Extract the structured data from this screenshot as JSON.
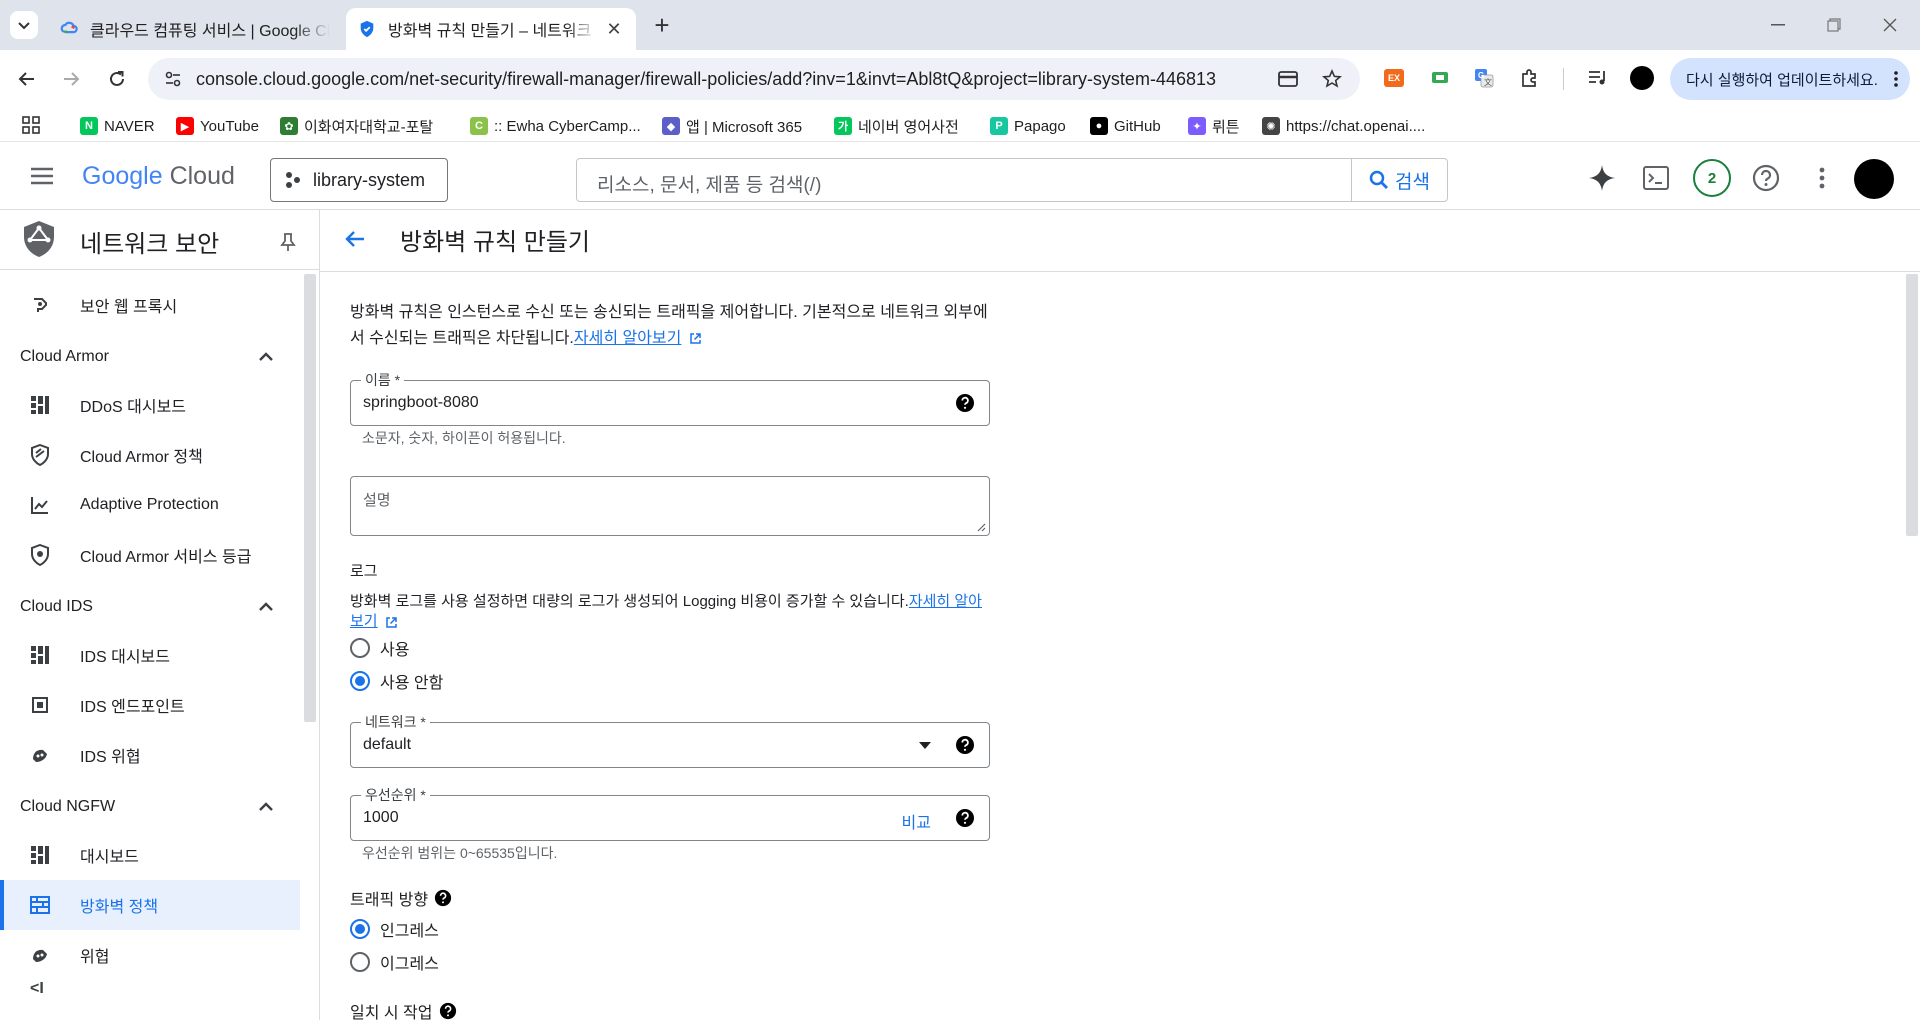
{
  "browser": {
    "tabs": [
      {
        "title": "클라우드 컴퓨팅 서비스 | Google Cloud",
        "active": false
      },
      {
        "title": "방화벽 규칙 만들기 – 네트워크 보안",
        "active": true
      }
    ],
    "new_tab_label": "+",
    "url": "console.cloud.google.com/net-security/firewall-manager/firewall-policies/add?inv=1&invt=Abl8tQ&project=library-system-446813",
    "update_label": "다시 실행하여 업데이트하세요.",
    "ext_ex_label": "EX",
    "bookmarks": [
      {
        "label": "NAVER",
        "color": "#03c75a",
        "icon": "N"
      },
      {
        "label": "YouTube",
        "color": "#ff0000",
        "icon": "▶"
      },
      {
        "label": "이화여자대학교-포탈",
        "color": "#2e7d32",
        "icon": "✿"
      },
      {
        "label": ":: Ewha CyberCamp...",
        "color": "#8bc34a",
        "icon": "C"
      },
      {
        "label": "앱 | Microsoft 365",
        "color": "#5b5fc7",
        "icon": "◆"
      },
      {
        "label": "네이버 영어사전",
        "color": "#03c75a",
        "icon": "가"
      },
      {
        "label": "Papago",
        "color": "#16c7a0",
        "icon": "P"
      },
      {
        "label": "GitHub",
        "color": "#000000",
        "icon": "●"
      },
      {
        "label": "뤼튼",
        "color": "#7c5cff",
        "icon": "✦"
      },
      {
        "label": "https://chat.openai....",
        "color": "#444444",
        "icon": "✺"
      }
    ]
  },
  "header": {
    "logo_google": "Google",
    "logo_cloud": "Cloud",
    "project": "library-system",
    "search_placeholder": "리소스, 문서, 제품 등 검색(/)",
    "search_button": "검색",
    "notification_count": "2"
  },
  "sidebar": {
    "title": "네트워크 보안",
    "top_item": {
      "label": "보안 웹 프록시",
      "icon": "proxy-icon"
    },
    "sections": [
      {
        "title": "Cloud Armor",
        "items": [
          {
            "label": "DDoS 대시보드",
            "icon": "dashboard-icon"
          },
          {
            "label": "Cloud Armor 정책",
            "icon": "shield-icon"
          },
          {
            "label": "Adaptive Protection",
            "icon": "chart-icon"
          },
          {
            "label": "Cloud Armor 서비스 등급",
            "icon": "tier-icon"
          }
        ]
      },
      {
        "title": "Cloud IDS",
        "items": [
          {
            "label": "IDS 대시보드",
            "icon": "dashboard-icon"
          },
          {
            "label": "IDS 엔드포인트",
            "icon": "endpoint-icon"
          },
          {
            "label": "IDS 위협",
            "icon": "threat-icon"
          }
        ]
      },
      {
        "title": "Cloud NGFW",
        "items": [
          {
            "label": "대시보드",
            "icon": "dashboard-icon"
          },
          {
            "label": "방화벽 정책",
            "icon": "firewall-icon",
            "active": true
          },
          {
            "label": "위협",
            "icon": "threat-icon"
          }
        ]
      }
    ],
    "collapse_label": "<I"
  },
  "page": {
    "title": "방화벽 규칙 만들기",
    "intro": "방화벽 규칙은 인스턴스로 수신 또는 송신되는 트래픽을 제어합니다. 기본적으로 네트워크 외부에서 수신되는 트래픽은 차단됩니다.",
    "intro_link": "자세히 알아보기",
    "name_label": "이름 *",
    "name_value": "springboot-8080",
    "name_hint": "소문자, 숫자, 하이픈이 허용됩니다.",
    "description_label": "설명",
    "logs_title": "로그",
    "logs_desc": "방화벽 로그를 사용 설정하면 대량의 로그가 생성되어 Logging 비용이 증가할 수 있습니다.",
    "logs_link": "자세히 알아보기",
    "logs_options": [
      {
        "label": "사용",
        "selected": false
      },
      {
        "label": "사용 안함",
        "selected": true
      }
    ],
    "network_label": "네트워크 *",
    "network_value": "default",
    "priority_label": "우선순위 *",
    "priority_value": "1000",
    "priority_compare": "비교",
    "priority_hint": "우선순위 범위는 0~65535입니다.",
    "direction_title": "트래픽 방향",
    "direction_options": [
      {
        "label": "인그레스",
        "selected": true
      },
      {
        "label": "이그레스",
        "selected": false
      }
    ],
    "action_title": "일치 시 작업"
  },
  "colors": {
    "accent": "#1a73e8",
    "active_bg": "#e8f0fe",
    "tabstrip": "#dfe3eb"
  }
}
